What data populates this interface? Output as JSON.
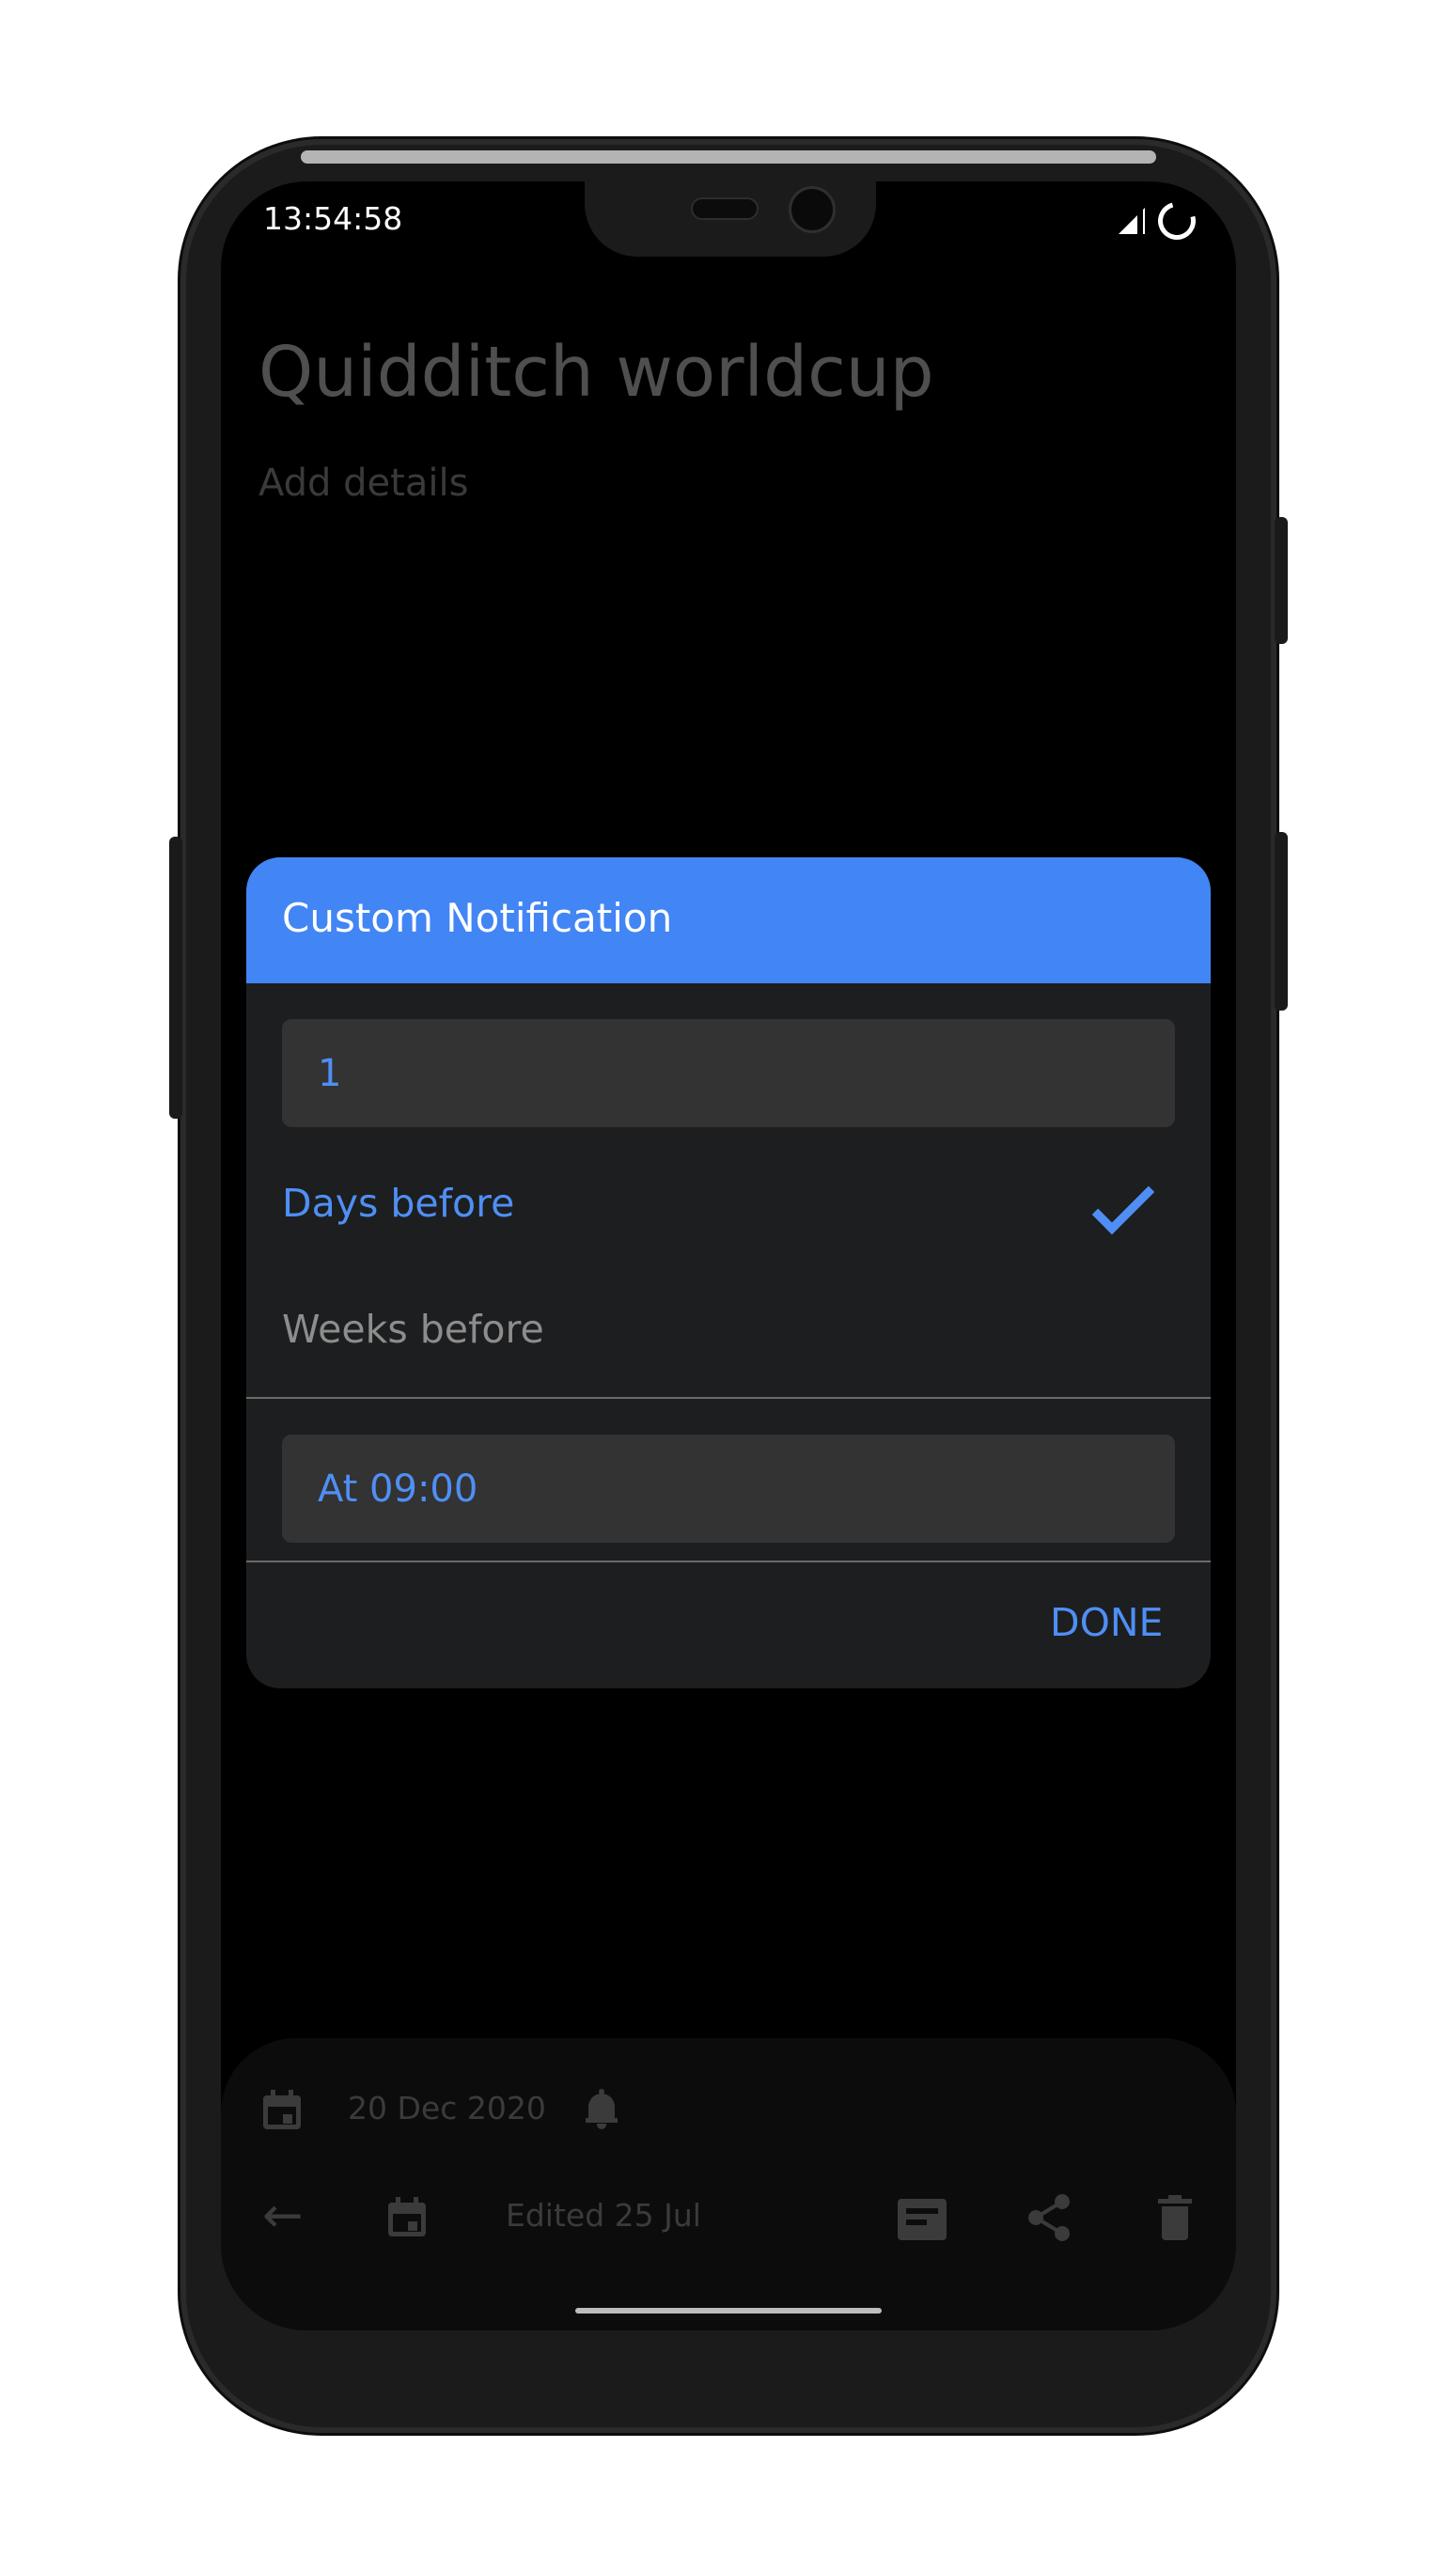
{
  "status_bar": {
    "time": "13:54:58"
  },
  "note": {
    "title": "Quidditch worldcup",
    "details_placeholder": "Add details"
  },
  "bottom_bar": {
    "due_date": "20 Dec 2020",
    "edited": "Edited 25 Jul"
  },
  "dialog": {
    "title": "Custom Notification",
    "amount_value": "1",
    "options": [
      "Days before",
      "Weeks before"
    ],
    "selected_option": "Days before",
    "time_label": "At 09:00",
    "done_label": "DONE"
  },
  "colors": {
    "accent": "#4285f4",
    "dialog_bg": "#1d1e1f",
    "field_bg": "#333333"
  },
  "icons": [
    "calendar-icon",
    "bell-icon",
    "back-arrow-icon",
    "calendar-icon",
    "archive-icon",
    "share-icon",
    "trash-icon",
    "check-icon"
  ]
}
